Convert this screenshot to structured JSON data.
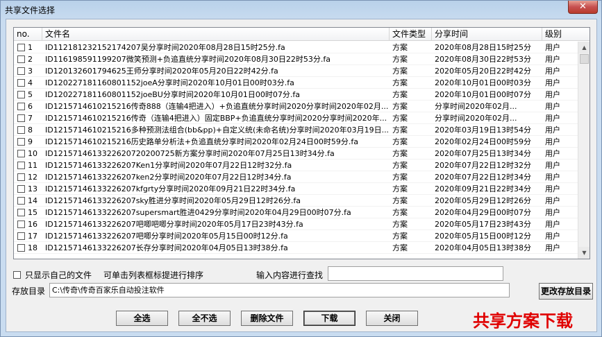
{
  "window": {
    "title": "共享文件选择",
    "close_label": "✕"
  },
  "table": {
    "headers": [
      "no.",
      "文件名",
      "文件类型",
      "分享时间",
      "级别"
    ],
    "rows": [
      {
        "no": "1",
        "name": "ID112181232152174207吴分享时间2020年08月28日15时25分.fa",
        "type": "方案",
        "time": "2020年08月28日15时25分",
        "level": "用户"
      },
      {
        "no": "2",
        "name": "ID116198591199207微笑预测+负追直统分享时间2020年08月30日22时53分.fa",
        "type": "方案",
        "time": "2020年08月30日22时53分",
        "level": "用户"
      },
      {
        "no": "3",
        "name": "ID120132601794625王师分享时间2020年05月20日22时42分.fa",
        "type": "方案",
        "time": "2020年05月20日22时42分",
        "level": "用户"
      },
      {
        "no": "4",
        "name": "ID120227181160801152joeA分享时间2020年10月01日00时03分.fa",
        "type": "方案",
        "time": "2020年10月01日00时03分",
        "level": "用户"
      },
      {
        "no": "5",
        "name": "ID120227181160801152joeBU分享时间2020年10月01日00时07分.fa",
        "type": "方案",
        "time": "2020年10月01日00时07分",
        "level": "用户"
      },
      {
        "no": "6",
        "name": "ID121571461021521­6传奇888（连输4把进入）+负追直统分享时间2020分享时间2020年02月...",
        "type": "方案",
        "time": "分享时间2020年02月...",
        "level": "用户"
      },
      {
        "no": "7",
        "name": "ID121571461021521­6传奇（连输4把进入）固定BBP+负追直统分享时间2020分享时间2020年...",
        "type": "方案",
        "time": "分享时间2020年02月...",
        "level": "用户"
      },
      {
        "no": "8",
        "name": "ID121571461021521­6多种预测法组合(bb&pp)+自定义统(未命名统)分享时间2020年03月19日...",
        "type": "方案",
        "time": "2020年03月19日13时54分",
        "level": "用户"
      },
      {
        "no": "9",
        "name": "ID121571461021521­6历史路单分析法+负追直统分享时间2020年02月24日00时59分.fa",
        "type": "方案",
        "time": "2020年02月24日00时59分",
        "level": "用户"
      },
      {
        "no": "10",
        "name": "ID121571461332262072020072­5新方案分享时间2020年07月25日13时34分.fa",
        "type": "方案",
        "time": "2020年07月25日13时34分",
        "level": "用户"
      },
      {
        "no": "11",
        "name": "ID12157146133226207Ken1分享时间2020年07月22日12时32分.fa",
        "type": "方案",
        "time": "2020年07月22日12时32分",
        "level": "用户"
      },
      {
        "no": "12",
        "name": "ID12157146133226207ken2分享时间2020年07月22日12时34分.fa",
        "type": "方案",
        "time": "2020年07月22日12时34分",
        "level": "用户"
      },
      {
        "no": "13",
        "name": "ID12157146133226207kfgrty分享时间2020年09月21日22时34分.fa",
        "type": "方案",
        "time": "2020年09月21日22时34分",
        "level": "用户"
      },
      {
        "no": "14",
        "name": "ID12157146133226207sky胜进分享时间2020年05月29日12时26分.fa",
        "type": "方案",
        "time": "2020年05月29日12时26分",
        "level": "用户"
      },
      {
        "no": "15",
        "name": "ID12157146133226207supersmart胜进0429分享时间2020年04月29日00时07分.fa",
        "type": "方案",
        "time": "2020年04月29日00时07分",
        "level": "用户"
      },
      {
        "no": "16",
        "name": "ID12157146133226207吧唧吧唧分享时间2020年05月17日23时43分.fa",
        "type": "方案",
        "time": "2020年05月17日23时43分",
        "level": "用户"
      },
      {
        "no": "17",
        "name": "ID12157146133226207吧唧分享时间2020年05月15日00时12分.fa",
        "type": "方案",
        "time": "2020年05月15日00时12分",
        "level": "用户"
      },
      {
        "no": "18",
        "name": "ID12157146133226207长存分享时间2020年04月05日13时38分.fa",
        "type": "方案",
        "time": "2020年04月05日13时38分",
        "level": "用户"
      }
    ]
  },
  "options": {
    "only_mine_label": "只显示自己的文件",
    "sort_hint": "可单击列表框标提进行排序",
    "search_label": "输入内容进行查找",
    "search_value": ""
  },
  "storage": {
    "label": "存放目录",
    "path": "C:\\传奇\\传奇百家乐自动投注软件",
    "change_button": "更改存放目录"
  },
  "buttons": {
    "select_all": "全选",
    "select_none": "全不选",
    "delete": "删除文件",
    "download": "下载",
    "close": "关闭"
  },
  "banner": "共享方案下载"
}
